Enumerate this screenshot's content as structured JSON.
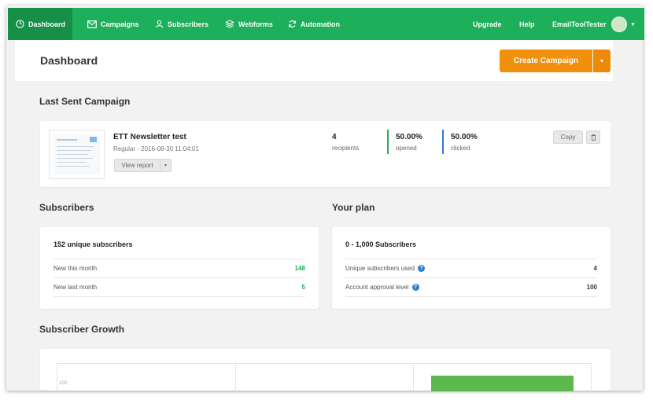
{
  "nav": {
    "items": [
      {
        "label": "Dashboard",
        "icon": "dashboard-icon"
      },
      {
        "label": "Campaigns",
        "icon": "envelope-icon"
      },
      {
        "label": "Subscribers",
        "icon": "user-icon"
      },
      {
        "label": "Webforms",
        "icon": "layers-icon"
      },
      {
        "label": "Automation",
        "icon": "sync-icon"
      }
    ],
    "upgrade": "Upgrade",
    "help": "Help",
    "account": "EmailToolTester"
  },
  "header": {
    "title": "Dashboard",
    "create_campaign": "Create Campaign"
  },
  "last_sent": {
    "section_title": "Last Sent Campaign",
    "name": "ETT Newsletter test",
    "meta": "Regular - 2016-08-30 11:04:01",
    "view_report": "View report",
    "recipients_value": "4",
    "recipients_label": "recipients",
    "opened_value": "50.00%",
    "opened_label": "opened",
    "clicked_value": "50.00%",
    "clicked_label": "clicked",
    "copy_label": "Copy",
    "colors": {
      "opened": "#1daf5a",
      "clicked": "#2b7bd6"
    }
  },
  "subscribers": {
    "section_title": "Subscribers",
    "unique": "152 unique subscribers",
    "rows": [
      {
        "label": "New this month",
        "value": "148"
      },
      {
        "label": "New last month",
        "value": "5"
      }
    ]
  },
  "plan": {
    "section_title": "Your plan",
    "name": "0 - 1,000 Subscribers",
    "rows": [
      {
        "label": "Unique subscribers used",
        "value": "4"
      },
      {
        "label": "Account approval level",
        "value": "100"
      }
    ]
  },
  "growth": {
    "section_title": "Subscriber Growth",
    "y_tick": "100"
  },
  "colors": {
    "brand": "#1daf5a",
    "accent": "#f0900d",
    "background": "#f2f2f2"
  }
}
